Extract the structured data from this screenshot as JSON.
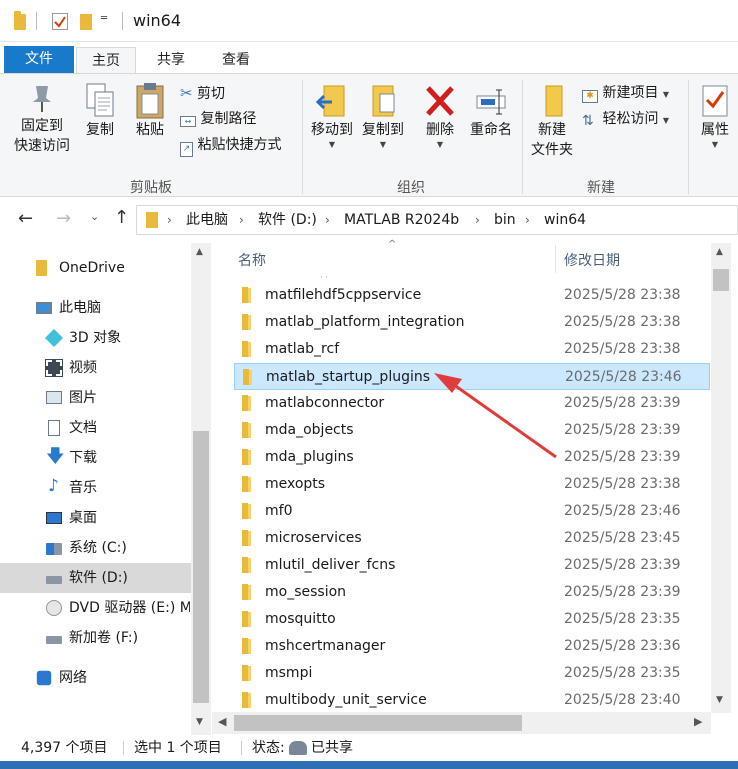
{
  "window": {
    "title": "win64"
  },
  "ribbon_tabs": {
    "file": "文件",
    "home": "主页",
    "share": "共享",
    "view": "查看"
  },
  "clipboard": {
    "pin": "固定到\n快速访问",
    "pin_line1": "固定到",
    "pin_line2": "快速访问",
    "copy": "复制",
    "paste": "粘贴",
    "cut": "剪切",
    "copy_path": "复制路径",
    "paste_shortcut": "粘贴快捷方式",
    "group_label": "剪贴板"
  },
  "organize": {
    "move_to": "移动到",
    "copy_to": "复制到",
    "delete": "删除",
    "rename": "重命名",
    "group_label": "组织"
  },
  "new_group": {
    "new_folder_line1": "新建",
    "new_folder_line2": "文件夹",
    "new_item": "新建项目",
    "easy_access": "轻松访问",
    "group_label": "新建"
  },
  "open_group": {
    "properties": "属性"
  },
  "address": {
    "crumbs": [
      "此电脑",
      "软件 (D:)",
      "MATLAB R2024b",
      "bin",
      "win64"
    ]
  },
  "nav_pane": {
    "items": [
      {
        "label": "OneDrive",
        "icon": "onedrive-folder-icon"
      },
      {
        "label": "此电脑",
        "icon": "computer-icon"
      },
      {
        "label": "3D 对象",
        "icon": "3d-objects-icon"
      },
      {
        "label": "视频",
        "icon": "video-icon"
      },
      {
        "label": "图片",
        "icon": "pictures-icon"
      },
      {
        "label": "文档",
        "icon": "documents-icon"
      },
      {
        "label": "下载",
        "icon": "downloads-icon"
      },
      {
        "label": "音乐",
        "icon": "music-icon"
      },
      {
        "label": "桌面",
        "icon": "desktop-icon"
      },
      {
        "label": "系统 (C:)",
        "icon": "system-drive-icon"
      },
      {
        "label": "软件 (D:)",
        "icon": "drive-icon"
      },
      {
        "label": "DVD 驱动器 (E:) M",
        "icon": "dvd-drive-icon"
      },
      {
        "label": "新加卷 (F:)",
        "icon": "drive-icon"
      },
      {
        "label": "网络",
        "icon": "network-icon"
      }
    ]
  },
  "file_list": {
    "columns": {
      "name": "名称",
      "modified": "修改日期"
    },
    "rows": [
      {
        "name": "matfilehdf5cppservice",
        "date": "2025/5/28 23:38"
      },
      {
        "name": "matlab_platform_integration",
        "date": "2025/5/28 23:38"
      },
      {
        "name": "matlab_rcf",
        "date": "2025/5/28 23:38"
      },
      {
        "name": "matlab_startup_plugins",
        "date": "2025/5/28 23:46"
      },
      {
        "name": "matlabconnector",
        "date": "2025/5/28 23:39"
      },
      {
        "name": "mda_objects",
        "date": "2025/5/28 23:39"
      },
      {
        "name": "mda_plugins",
        "date": "2025/5/28 23:39"
      },
      {
        "name": "mexopts",
        "date": "2025/5/28 23:38"
      },
      {
        "name": "mf0",
        "date": "2025/5/28 23:46"
      },
      {
        "name": "microservices",
        "date": "2025/5/28 23:45"
      },
      {
        "name": "mlutil_deliver_fcns",
        "date": "2025/5/28 23:39"
      },
      {
        "name": "mo_session",
        "date": "2025/5/28 23:39"
      },
      {
        "name": "mosquitto",
        "date": "2025/5/28 23:35"
      },
      {
        "name": "mshcertmanager",
        "date": "2025/5/28 23:36"
      },
      {
        "name": "msmpi",
        "date": "2025/5/28 23:35"
      },
      {
        "name": "multibody_unit_service",
        "date": "2025/5/28 23:40"
      }
    ]
  },
  "status_bar": {
    "item_count": "4,397 个项目",
    "selected": "选中 1 个项目",
    "state_label": "状态:",
    "state_value": "已共享"
  },
  "colors": {
    "accent": "#1979ca",
    "selection": "#cce8ff",
    "annotation_arrow": "#e03c3c",
    "folder": "#e8b93a"
  }
}
